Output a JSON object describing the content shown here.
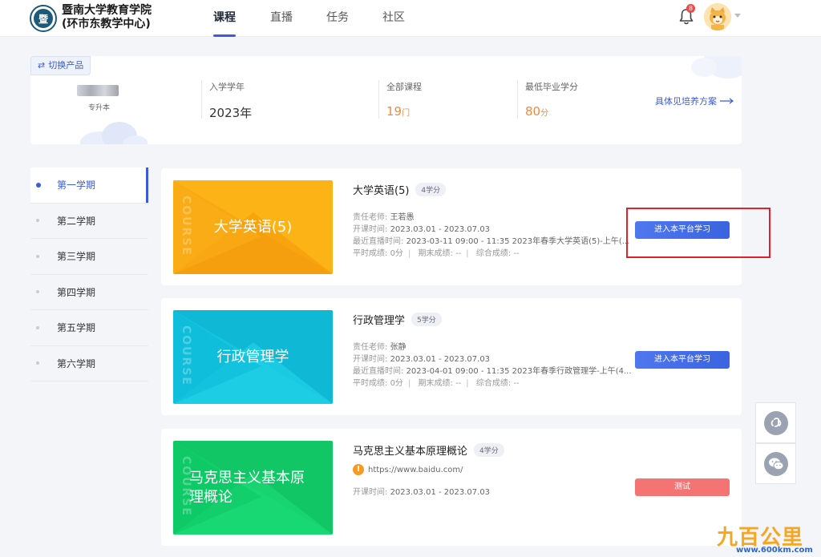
{
  "header": {
    "school_line1": "暨南大学教育学院",
    "school_line2": "(环市东教学中心)",
    "nav": [
      {
        "label": "课程",
        "active": true
      },
      {
        "label": "直播",
        "active": false
      },
      {
        "label": "任务",
        "active": false
      },
      {
        "label": "社区",
        "active": false
      }
    ],
    "notification_count": "8",
    "icons": {
      "bell": "bell-icon",
      "avatar": "cat-avatar",
      "caret": "caret-down-icon"
    }
  },
  "profile": {
    "switch_label": "切换产品",
    "level": "专升本",
    "stats": [
      {
        "label": "入学学年",
        "value": "2023年",
        "unit": "",
        "accent": false
      },
      {
        "label": "全部课程",
        "value": "19",
        "unit": "门",
        "accent": true
      },
      {
        "label": "最低毕业学分",
        "value": "80",
        "unit": "分",
        "accent": true
      }
    ],
    "plan_link": "具体见培养方案"
  },
  "terms": [
    {
      "label": "第一学期",
      "active": true
    },
    {
      "label": "第二学期",
      "active": false
    },
    {
      "label": "第三学期",
      "active": false
    },
    {
      "label": "第四学期",
      "active": false
    },
    {
      "label": "第五学期",
      "active": false
    },
    {
      "label": "第六学期",
      "active": false
    }
  ],
  "courses": [
    {
      "cover_title": "大学英语(5)",
      "cover_watermark": "COURSE",
      "title": "大学英语(5)",
      "credit": "4学分",
      "teacher_label": "责任老师:",
      "teacher": "王若愚",
      "open_label": "开课时间:",
      "open_time": "2023.03.01 - 2023.07.03",
      "live_label": "最近直播时间:",
      "live_time": "2023-03-11 09:00 - 11:35  2023年春季大学英语(5)-上午(...",
      "usual_label": "平时成绩:",
      "usual_score": "0分",
      "final_label": "期末成绩:",
      "final_score": "--",
      "total_label": "综合成绩:",
      "total_score": "--",
      "button": "进入本平台学习"
    },
    {
      "cover_title": "行政管理学",
      "cover_watermark": "COURSE",
      "title": "行政管理学",
      "credit": "5学分",
      "teacher_label": "责任老师:",
      "teacher": "张静",
      "open_label": "开课时间:",
      "open_time": "2023.03.01 - 2023.07.03",
      "live_label": "最近直播时间:",
      "live_time": "2023-04-01 09:00 - 11:35  2023年春季行政管理学-上午(4...",
      "usual_label": "平时成绩:",
      "usual_score": "0分",
      "final_label": "期末成绩:",
      "final_score": "--",
      "total_label": "综合成绩:",
      "total_score": "--",
      "button": "进入本平台学习"
    },
    {
      "cover_title": "马克思主义基本原理概论",
      "cover_watermark": "COURSE",
      "title": "马克思主义基本原理概论",
      "credit": "4学分",
      "url": "https://www.baidu.com/",
      "open_label": "开课时间:",
      "open_time": "2023.03.01 - 2023.07.03",
      "button": "测试"
    }
  ],
  "colors": {
    "accent": "#3b5bdb",
    "orange": "#f08a3c",
    "cover_orange": "#f7a712",
    "cover_cyan": "#15c4dd",
    "cover_green": "#12cf6a",
    "test_button": "#f47373",
    "highlight_box": "#e3212b"
  },
  "watermark": {
    "logo": "九百公里",
    "url": "www.600km.com"
  }
}
